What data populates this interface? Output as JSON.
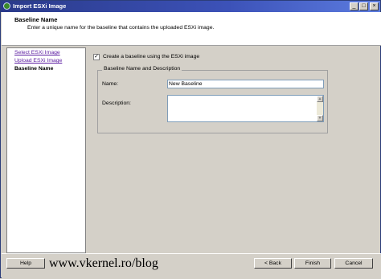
{
  "window": {
    "title": "Import ESXi Image",
    "controls": {
      "minimize": "_",
      "maximize": "□",
      "close": "×"
    }
  },
  "header": {
    "title": "Baseline Name",
    "description": "Enter a unique name for the baseline that contains the uploaded ESXi image."
  },
  "nav": {
    "items": [
      {
        "label": "Select ESXi Image",
        "state": "link"
      },
      {
        "label": "Upload ESXi Image",
        "state": "link"
      },
      {
        "label": "Baseline Name",
        "state": "current"
      }
    ]
  },
  "form": {
    "create_baseline_checkbox": {
      "label": "Create a baseline using the ESXi image",
      "checked": true
    },
    "group_title": "Baseline Name and Description",
    "name_label": "Name:",
    "name_value": "New Baseline",
    "description_label": "Description:",
    "description_value": ""
  },
  "footer": {
    "help": "Help",
    "back": "< Back",
    "finish": "Finish",
    "cancel": "Cancel",
    "watermark": "www.vkernel.ro/blog"
  }
}
